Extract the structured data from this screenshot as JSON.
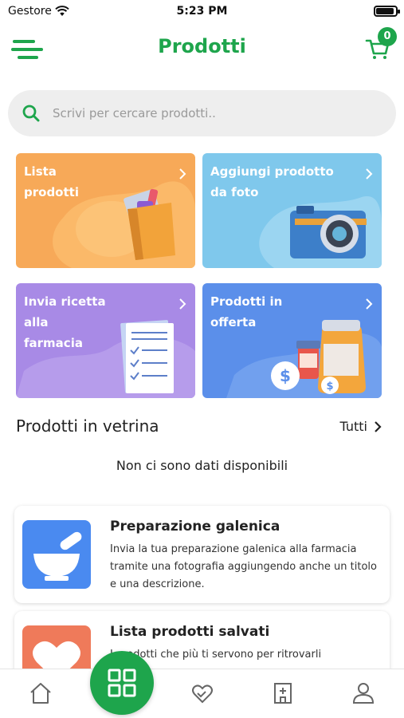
{
  "status_bar": {
    "carrier": "Gestore",
    "time": "5:23 PM"
  },
  "header": {
    "title": "Prodotti",
    "cart_count": "0"
  },
  "search": {
    "placeholder": "Scrivi per cercare prodotti.."
  },
  "tiles": [
    {
      "label": "Lista\nprodotti",
      "color": "#f7a958"
    },
    {
      "label": "Aggiungi prodotto\nda foto",
      "color": "#7fc8ec"
    },
    {
      "label": "Invia ricetta\nalla\nfarmacia",
      "color": "#a88ae6"
    },
    {
      "label": "Prodotti in\nofferta",
      "color": "#5b8fea"
    }
  ],
  "showcase": {
    "title": "Prodotti in vetrina",
    "see_all": "Tutti",
    "empty": "Non ci sono dati disponibili"
  },
  "cards": [
    {
      "title": "Preparazione galenica",
      "description": "Invia la tua preparazione galenica alla farmacia tramite una fotografia aggiungendo anche un titolo e una descrizione.",
      "icon": "mortar-icon",
      "color": "#4a8af0"
    },
    {
      "title": "Lista prodotti salvati",
      "description": "I prodotti che più ti servono per ritrovarli",
      "icon": "heart-icon",
      "color": "#ef7a5a"
    }
  ],
  "bottom_nav": [
    "home-icon",
    "grid-icon",
    "heart-hand-icon",
    "pharmacy-icon",
    "user-icon"
  ],
  "colors": {
    "accent": "#1ea54c"
  }
}
